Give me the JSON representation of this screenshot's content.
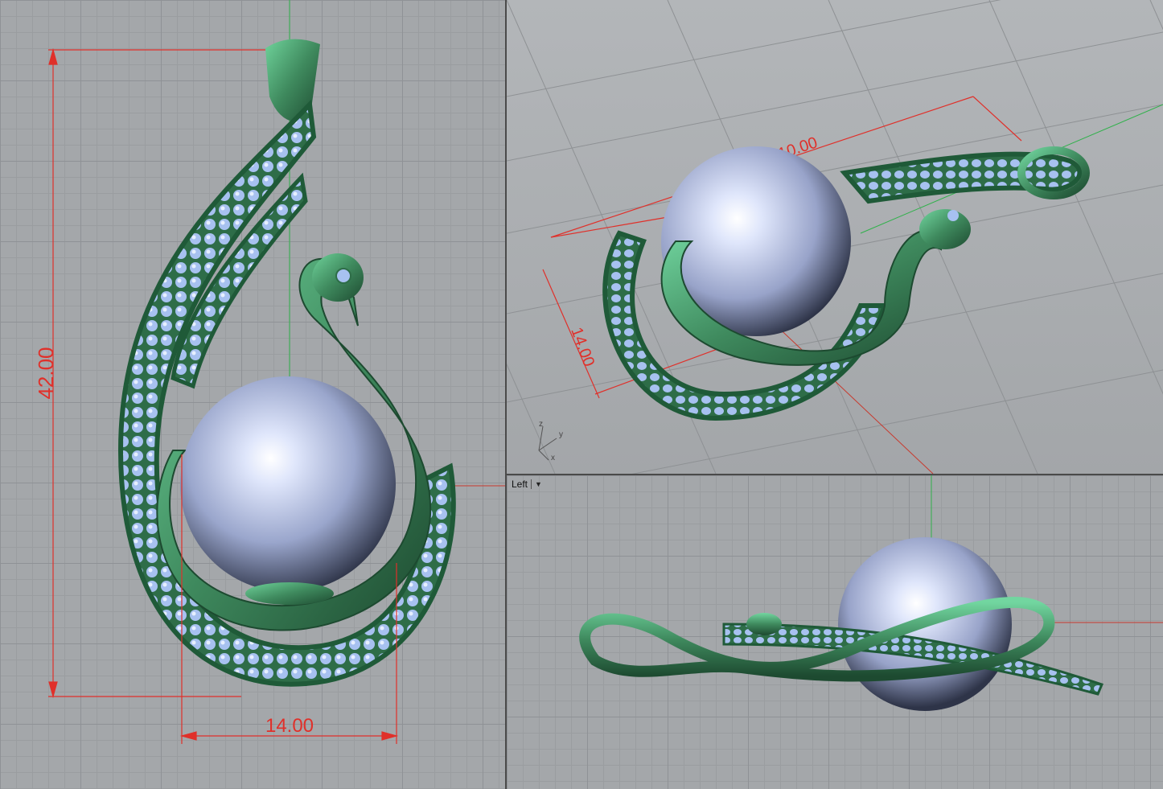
{
  "viewports": {
    "front": {
      "dim_height": "42.00",
      "dim_width": "14.00"
    },
    "perspective": {
      "dim_depth": "14.00",
      "dim_width": "10.00",
      "axis_z": "z",
      "axis_y": "y",
      "axis_x": "x"
    },
    "left": {
      "label": "Left"
    }
  },
  "colors": {
    "metal": "#3f8a5e",
    "pearl": "#b8c2e0",
    "gem": "#9ab6ea",
    "dimension": "#e0302a",
    "grid_bg": "#a4a7aa"
  },
  "icons": {
    "viewport_menu": "chevron-down-icon"
  }
}
